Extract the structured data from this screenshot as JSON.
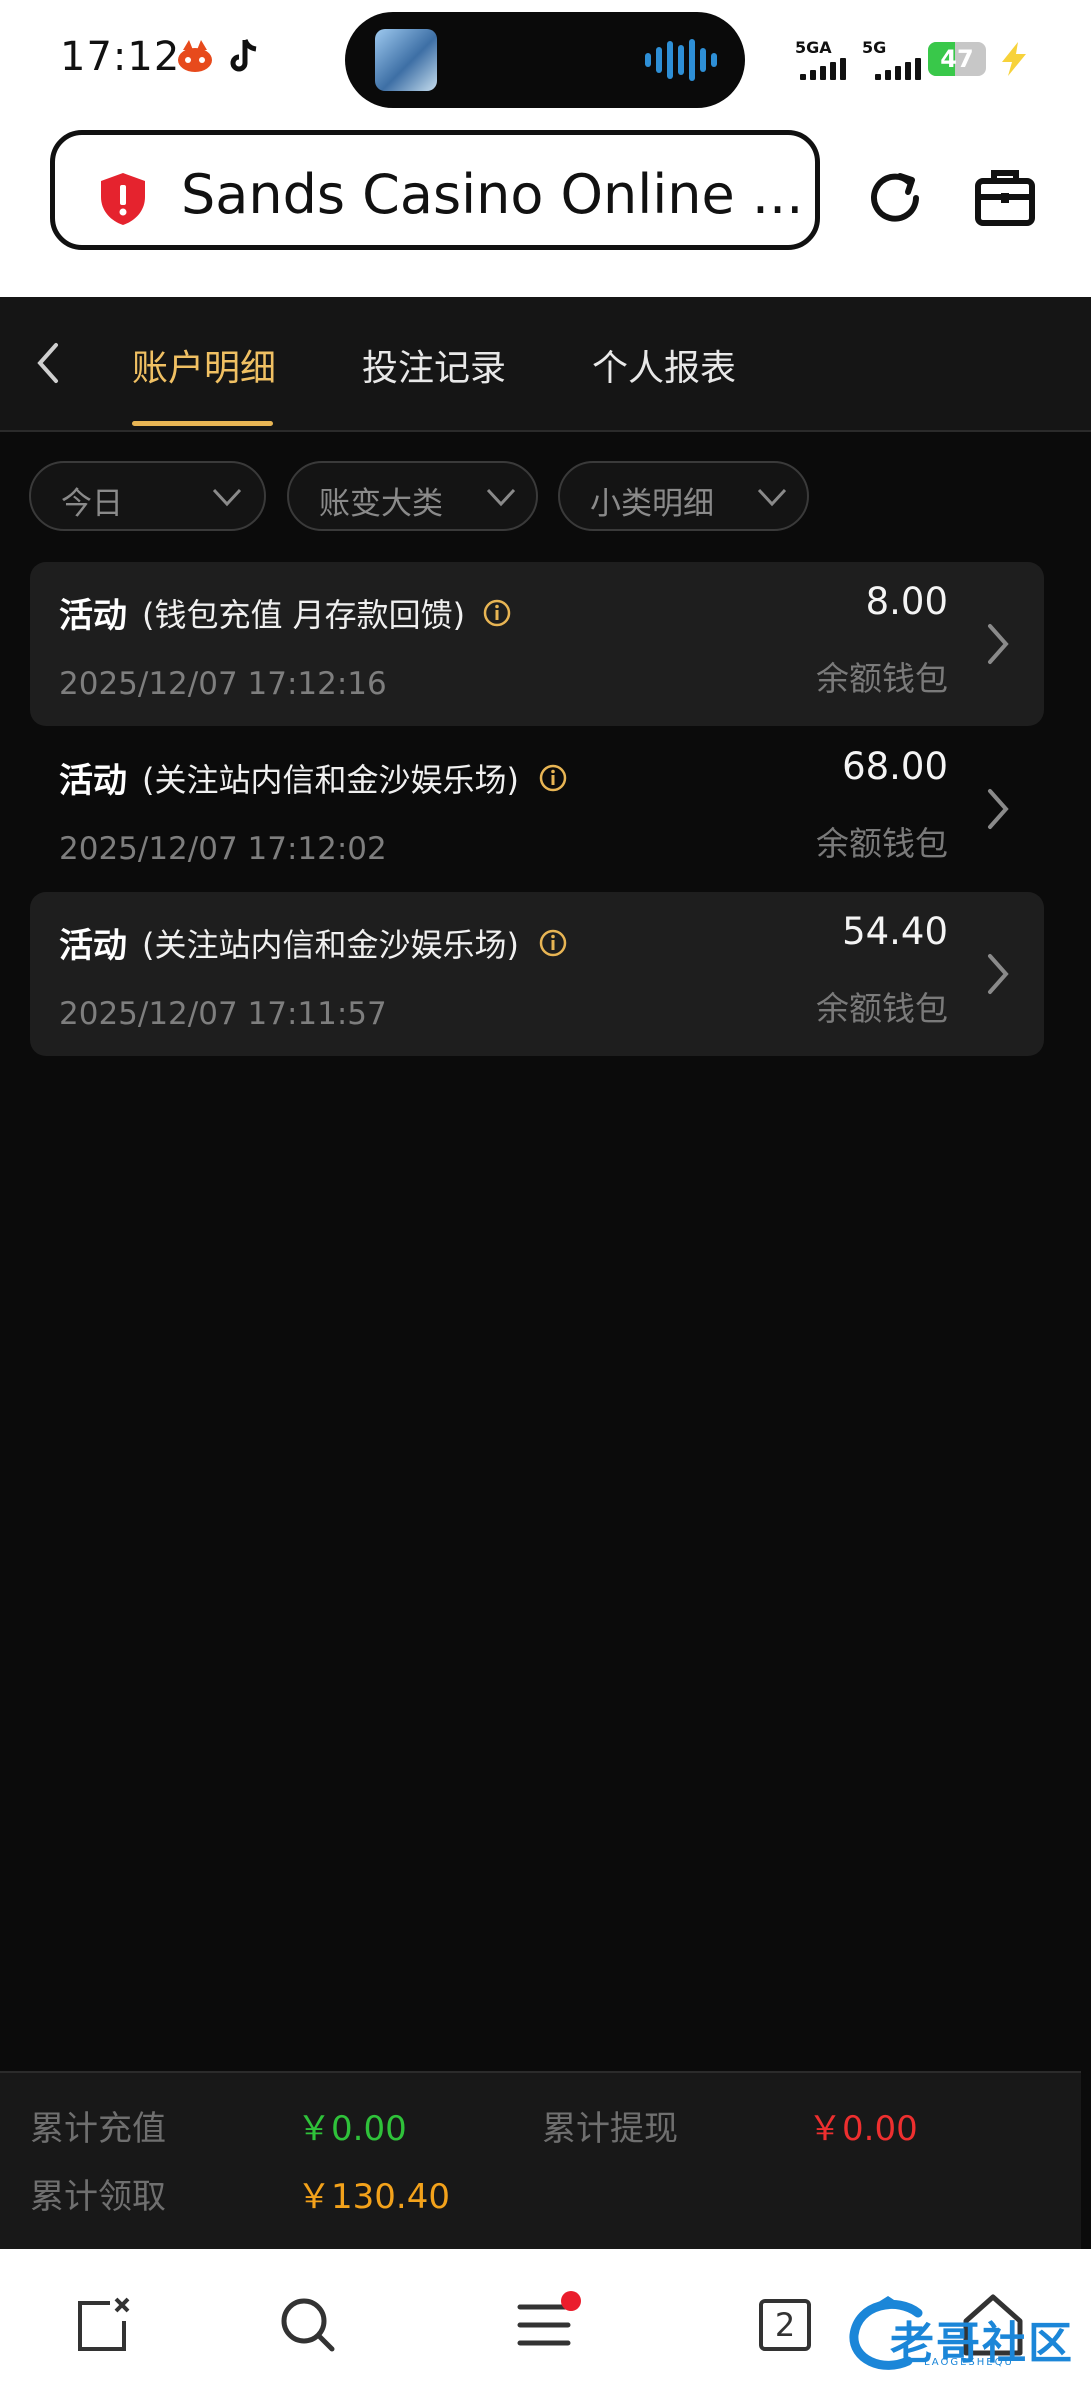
{
  "status_bar": {
    "time": "17:12",
    "network_1": "5GA",
    "network_2": "5G",
    "battery_level": "47",
    "battery_percent": 47,
    "icons": [
      "app-notification-icon",
      "tiktok-icon",
      "signal-icon",
      "battery-icon",
      "charging-icon"
    ]
  },
  "browser": {
    "url_text": "Sands Casino Online ...",
    "icons": [
      "security-shield-icon",
      "reload-icon",
      "toolbox-icon"
    ],
    "accent": "#e5232e"
  },
  "header": {
    "tabs": [
      {
        "label": "账户明细",
        "active": true
      },
      {
        "label": "投注记录",
        "active": false
      },
      {
        "label": "个人报表",
        "active": false
      }
    ],
    "active_color": "#f0c063"
  },
  "filters": [
    {
      "label": "今日"
    },
    {
      "label": "账变大类"
    },
    {
      "label": "小类明细"
    }
  ],
  "records": [
    {
      "type": "活动",
      "desc": "(钱包充值 月存款回馈)",
      "time": "2025/12/07 17:12:16",
      "amount": "8.00",
      "wallet": "余额钱包"
    },
    {
      "type": "活动",
      "desc": "(关注站内信和金沙娱乐场)",
      "time": "2025/12/07 17:12:02",
      "amount": "68.00",
      "wallet": "余额钱包"
    },
    {
      "type": "活动",
      "desc": "(关注站内信和金沙娱乐场)",
      "time": "2025/12/07 17:11:57",
      "amount": "54.40",
      "wallet": "余额钱包"
    }
  ],
  "summary": {
    "deposit_label": "累计充值",
    "deposit_value": "￥0.00",
    "withdraw_label": "累计提现",
    "withdraw_value": "￥0.00",
    "claimed_label": "累计领取",
    "claimed_value": "￥130.40",
    "colors": {
      "deposit": "#2fc23a",
      "withdraw": "#ee2f2f",
      "claimed": "#f3a21b"
    }
  },
  "bottom_nav": {
    "tab_count": "2",
    "icons": [
      "close-tab-icon",
      "search-icon",
      "menu-icon",
      "tabs-icon",
      "home-icon"
    ]
  },
  "watermark": {
    "text": "老哥社区",
    "subtext": "LAOGESHEQU"
  }
}
